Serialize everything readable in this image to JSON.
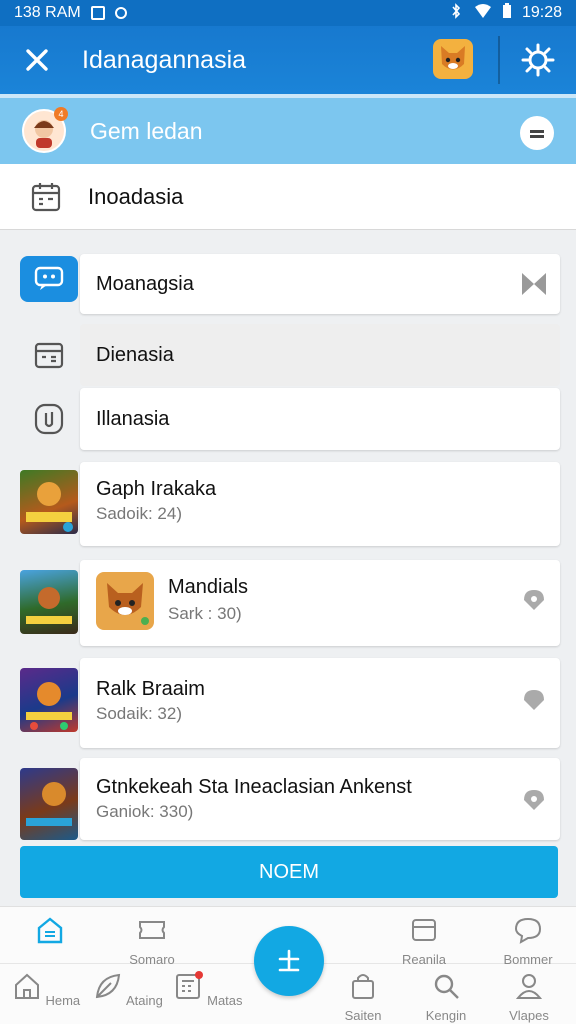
{
  "statusbar": {
    "time_left": "138 RAM",
    "time_right": "19:28"
  },
  "appbar": {
    "title": "Idanagannasia"
  },
  "banner": {
    "label": "Gem ledan",
    "badge": "4"
  },
  "section": {
    "label": "Inoadasia"
  },
  "menu": [
    {
      "label": "Moanagsia"
    },
    {
      "label": "Dienasia"
    },
    {
      "label": "Illanasia"
    }
  ],
  "games": [
    {
      "title": "Gaph Irakaka",
      "sub": "Sadoik: 24)"
    },
    {
      "title": "Mandials",
      "sub": "Sark : 30)"
    },
    {
      "title": "Ralk Braaim",
      "sub": "Sodaik: 32)"
    },
    {
      "title": "Gtnkekeah Sta Ineaclasian Ankenst",
      "sub": "Ganiok: 330)"
    }
  ],
  "cta": {
    "label": "NOEM"
  },
  "bottom_nav": {
    "top": [
      {
        "label": ""
      },
      {
        "label": "Somaro"
      },
      {
        "label": "Reanila"
      },
      {
        "label": "Bommer"
      }
    ],
    "bottom": [
      {
        "label": "Hema"
      },
      {
        "label": "Ataing"
      },
      {
        "label": "Matas"
      },
      {
        "label": "Saiten"
      },
      {
        "label": "Kengin"
      },
      {
        "label": "Vlapes"
      }
    ]
  },
  "colors": {
    "primary": "#1779cf",
    "accent": "#12a8e3",
    "banner": "#7cc6ef"
  }
}
